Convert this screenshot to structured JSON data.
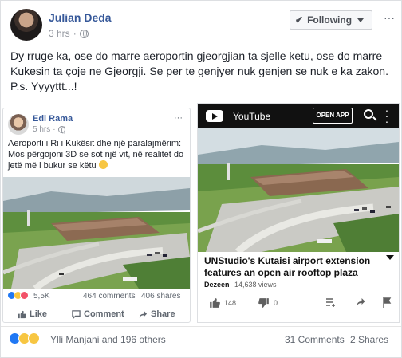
{
  "post": {
    "author": "Julian Deda",
    "time": "3 hrs",
    "follow_label": "Following",
    "more_label": "···",
    "text": "Dy rruge ka, ose do marre aeroportin gjeorgjian ta sjelle ketu, ose do marre Kukesin ta çoje ne Gjeorgji. Se per te genjyer nuk genjen se nuk e ka zakon. P.s. Yyyyttt...!"
  },
  "shared_left": {
    "author": "Edi Rama",
    "time": "5 hrs",
    "more_label": "···",
    "text": "Aeroporti i Ri i Kukësit dhe një paralajmërim: Mos përgojoni 3D se sot një vit, në realitet do jetë më i bukur se këtu",
    "reaction_count": "5,5K",
    "comments": "464 comments",
    "shares": "406 shares",
    "like": "Like",
    "comment": "Comment",
    "share": "Share"
  },
  "shared_right": {
    "app_name": "YouTube",
    "open_app": "OPEN APP",
    "title": "UNStudio's Kutaisi airport extension features an open air rooftop plaza",
    "channel": "Dezeen",
    "views": "14,638 views",
    "likes": "148",
    "dislikes": "0"
  },
  "footer": {
    "reactors": "Ylli Manjani and 196 others",
    "comments": "31 Comments",
    "shares": "2 Shares"
  },
  "colors": {
    "link_blue": "#365899",
    "like_blue": "#2078f4",
    "haha_yellow": "#f7c642",
    "love_red": "#f25268"
  }
}
